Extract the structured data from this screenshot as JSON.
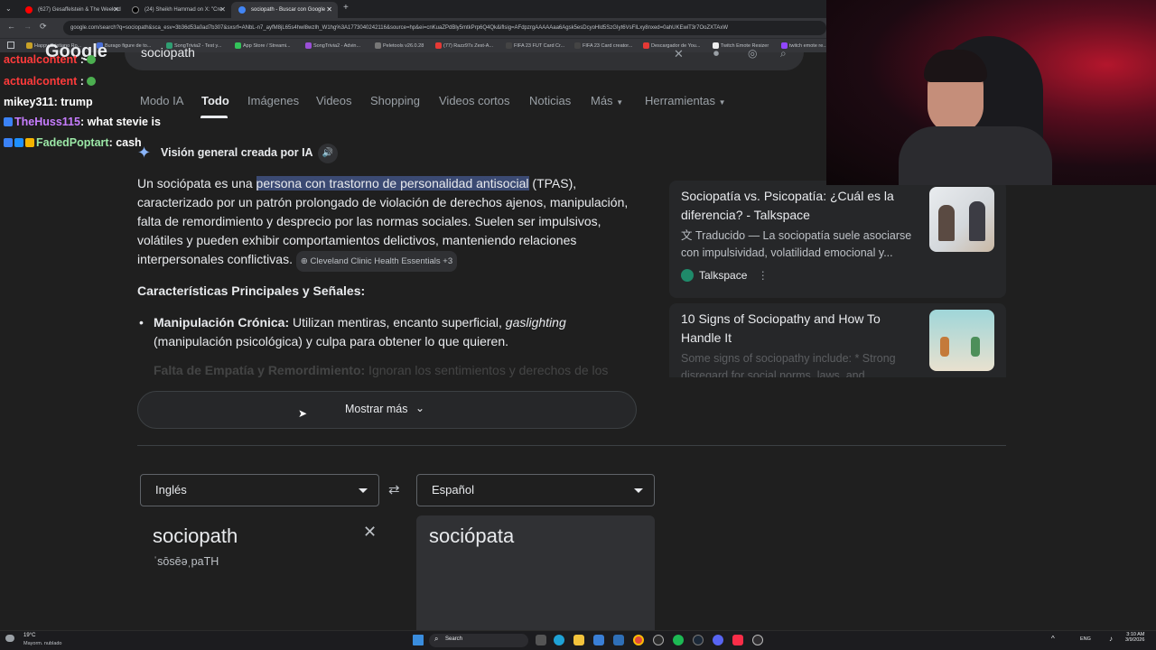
{
  "browser": {
    "tabs": [
      {
        "title": "(627) Gesaffelstein & The Weeknd"
      },
      {
        "title": "(24) Sheikh Hammad on X: \"Cre"
      },
      {
        "title": "sociopath - Buscar con Google"
      }
    ],
    "address": "google.com/search?q=sociopath&sca_esv=3b36d53a0ad7b307&sxsrf=ANbL-n7_ayfM8jL65s4hwl8wzIh_W1hg%3A1773040242116&source=hp&ei=cnKuaZPdBly5mtkPrp6Q4Qk&iflsig=AFdpzrgAAAAAaa6Agsk5esDcyoHld5SzGIyt6VsFILxy8nxed=0ahUKEwiT3r7OoZXTAxW",
    "bookmarks": [
      "Happy Cristiano Ro...",
      "Burago figure de to...",
      "SongTrivia2 - Test y...",
      "App Store / Streami...",
      "SongTrivia2 - Advin...",
      "Peletools v26.0.28",
      "(77) Razz97s Zest-A...",
      "FIFA 23 FUT Card Cr...",
      "FIFA 23 Card creator...",
      "Descargador de You...",
      "Twitch Emote Resizer",
      "twitch emote re..."
    ]
  },
  "search": {
    "query": "sociopath"
  },
  "nav": {
    "items": [
      "Modo IA",
      "Todo",
      "Imágenes",
      "Videos",
      "Shopping",
      "Videos cortos",
      "Noticias",
      "Más",
      "Herramientas"
    ]
  },
  "ai_overview": {
    "header": "Visión general creada por IA",
    "intro_before": "Un sociópata es una ",
    "intro_highlight": "persona con trastorno de personalidad antisocial",
    "intro_after": " (TPAS), caracterizado por un patrón prolongado de violación de derechos ajenos, manipulación, falta de remordimiento y desprecio por las normas sociales. Suelen ser impulsivos, volátiles y pueden exhibir comportamientos delictivos, manteniendo relaciones interpersonales conflictivas. ",
    "source_chip": "Cleveland Clinic Health Essentials +3",
    "section_title": "Características Principales y Señales:",
    "bullet1_bold": "Manipulación Crónica:",
    "bullet1_text": " Utilizan mentiras, encanto superficial, ",
    "bullet1_italic": "gaslighting",
    "bullet1_text2": " (manipulación psicológica) y culpa para obtener lo que quieren.",
    "bullet2_bold": "Falta de Empatía y Remordimiento:",
    "bullet2_text": " Ignoran los sentimientos y derechos de los",
    "show_more": "Mostrar más"
  },
  "cards": [
    {
      "title": "Sociopatía vs. Psicopatía: ¿Cuál es la diferencia? - Talkspace",
      "snippet": "Traducido — La sociopatía suele asociarse con impulsividad, volatilidad emocional y...",
      "source": "Talkspace"
    },
    {
      "title": "10 Signs of Sociopathy and How To Handle It",
      "snippet": "Some signs of sociopathy include: * Strong disregard for social norms, laws, and..."
    }
  ],
  "translate": {
    "source_lang": "Inglés",
    "target_lang": "Español",
    "source_word": "sociopath",
    "phonetic": "ˈsōsēəˌpaTH",
    "target_word": "sociópata"
  },
  "chat": [
    {
      "user": "actualcontent",
      "msg": "",
      "color": "#ff3b3b"
    },
    {
      "user": "actualcontent",
      "msg": "",
      "color": "#ff3b3b"
    },
    {
      "user": "mikey311",
      "msg": ": trump",
      "color": "#ffffff"
    },
    {
      "user": "TheHuss115",
      "msg": ": what stevie is",
      "color": "#c77dff"
    },
    {
      "user": "FadedPoptart",
      "msg": ": cash",
      "color": "#9be7a6"
    }
  ],
  "taskbar": {
    "weather_temp": "19°C",
    "weather_desc": "Mayorm. nublado",
    "search_label": "Search",
    "lang": "ENG",
    "time": "3:10 AM",
    "date": "3/9/2026"
  },
  "colors": {
    "page_bg": "#1f1f1f",
    "highlight": "#3b4a73",
    "chat_red": "#ff3b3b",
    "chat_purple": "#c77dff",
    "chat_green": "#9be7a6"
  }
}
